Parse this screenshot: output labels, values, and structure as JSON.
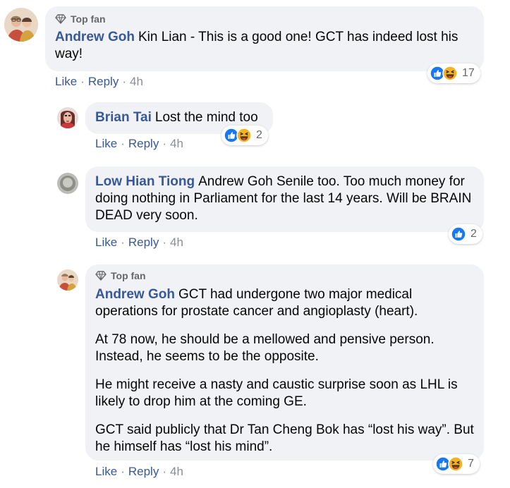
{
  "comments": [
    {
      "badge": "Top fan",
      "author": "Andrew Goh",
      "paragraphs": [
        "Kin Lian - This is a good one! GCT has indeed lost his way!"
      ],
      "actions": {
        "like": "Like",
        "reply": "Reply",
        "time": "4h",
        "sep": "·"
      },
      "reactions": {
        "icons": [
          "like-icon",
          "haha-icon"
        ],
        "count": "17"
      }
    },
    {
      "author": "Brian Tai",
      "paragraphs": [
        "Lost the mind too"
      ],
      "actions": {
        "like": "Like",
        "reply": "Reply",
        "time": "4h",
        "sep": "·"
      },
      "reactions": {
        "icons": [
          "like-icon",
          "haha-icon"
        ],
        "count": "2"
      }
    },
    {
      "author": "Low Hian Tiong",
      "paragraphs": [
        "Andrew Goh Senile too. Too much money for doing nothing in Parliament for the last 14 years. Will be BRAIN DEAD very soon."
      ],
      "actions": {
        "like": "Like",
        "reply": "Reply",
        "time": "4h",
        "sep": "·"
      },
      "reactions": {
        "icons": [
          "like-icon"
        ],
        "count": "2"
      }
    },
    {
      "badge": "Top fan",
      "author": "Andrew Goh",
      "paragraphs": [
        "GCT had undergone two major medical operations for prostate cancer and angioplasty (heart).",
        "At 78 now, he should be a mellowed and pensive person. Instead, he seems to be the opposite.",
        "He might receive a nasty and caustic surprise soon as LHL is likely to drop him at the coming GE.",
        "GCT said publicly that Dr Tan Cheng Bok has “lost his way”. But he himself has “lost his mind”."
      ],
      "actions": {
        "like": "Like",
        "reply": "Reply",
        "time": "4h",
        "sep": "·"
      },
      "reactions": {
        "icons": [
          "like-icon",
          "haha-icon"
        ],
        "count": "7"
      }
    }
  ],
  "colors": {
    "author": "#385898",
    "bubble": "#f0f2f5",
    "like_blue": "#1877f2",
    "haha_yellow": "#f7b125",
    "muted": "#65676b"
  }
}
